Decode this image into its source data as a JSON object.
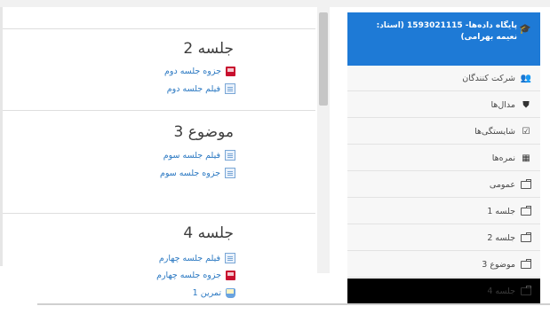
{
  "sections": [
    {
      "title": "جلسه 2",
      "activities": [
        {
          "type": "pdf",
          "label": "جزوه جلسه دوم"
        },
        {
          "type": "file",
          "label": "فیلم جلسه دوم"
        }
      ]
    },
    {
      "title": "موضوع 3",
      "activities": [
        {
          "type": "file",
          "label": "فیلم جلسه سوم"
        },
        {
          "type": "file",
          "label": "جزوه جلسه سوم"
        }
      ]
    },
    {
      "title": "جلسه 4",
      "activities": [
        {
          "type": "file",
          "label": "فیلم جلسه چهارم"
        },
        {
          "type": "pdf",
          "label": "جزوه جلسه چهارم"
        },
        {
          "type": "assign",
          "label": "تمرین 1"
        }
      ]
    }
  ],
  "nav": {
    "course_title": "پایگاه داده‌ها- 1593021115 (استاد: نعیمه بهرامی)",
    "items": [
      {
        "icon": "users-icon",
        "label": "شرکت کنندگان"
      },
      {
        "icon": "badge-icon",
        "label": "مدال‌ها"
      },
      {
        "icon": "checkbox-icon",
        "label": "شایستگی‌ها"
      },
      {
        "icon": "grades-icon",
        "label": "نمره‌ها"
      },
      {
        "icon": "folder-icon",
        "label": "عمومی"
      },
      {
        "icon": "folder-icon",
        "label": "جلسه 1"
      },
      {
        "icon": "folder-icon",
        "label": "جلسه 2"
      },
      {
        "icon": "folder-icon",
        "label": "موضوع 3"
      },
      {
        "icon": "folder-icon",
        "label": "جلسه 4"
      }
    ]
  },
  "colors": {
    "accent": "#1e7ad6",
    "link": "#2a78c2"
  }
}
